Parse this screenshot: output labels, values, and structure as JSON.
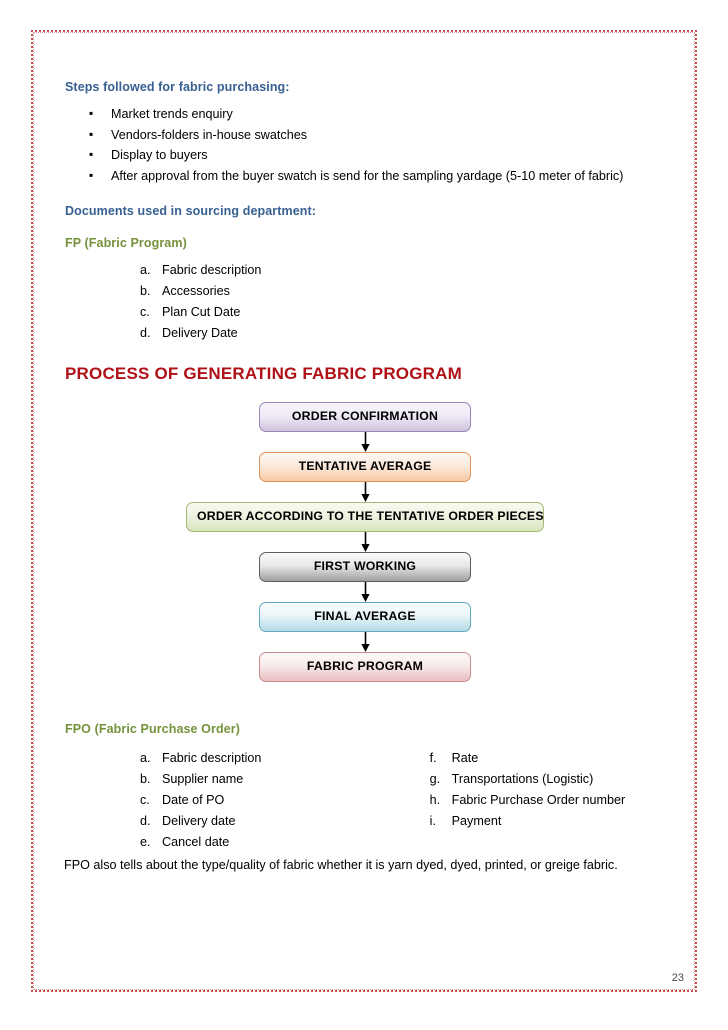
{
  "document": {
    "page_number": "23",
    "border_color": "#c0504d"
  },
  "section_steps": {
    "heading": "Steps followed for fabric purchasing:",
    "heading_color": "#376092",
    "bullets": [
      "Market trends enquiry",
      "Vendors-folders in-house swatches",
      "Display to buyers",
      "After approval from the buyer swatch is send for the sampling yardage (5-10 meter of fabric)"
    ]
  },
  "section_documents": {
    "heading": "Documents used in sourcing department:",
    "heading_color": "#376092"
  },
  "section_fp": {
    "heading": "FP (Fabric Program)",
    "heading_color": "#76923c",
    "items": [
      {
        "marker": "a.",
        "label": "Fabric description"
      },
      {
        "marker": "b.",
        "label": "Accessories"
      },
      {
        "marker": "c.",
        "label": "Plan Cut Date"
      },
      {
        "marker": "d.",
        "label": "Delivery Date"
      }
    ]
  },
  "section_process": {
    "heading": "PROCESS OF GENERATING FABRIC PROGRAM",
    "heading_color": "#b01116",
    "flowchart": {
      "steps": [
        {
          "label": "ORDER CONFIRMATION",
          "color": "#cfc3df"
        },
        {
          "label": "TENTATIVE AVERAGE",
          "color": "#f7c9a4"
        },
        {
          "label": "ORDER ACCORDING TO THE TENTATIVE ORDER PIECES",
          "color": "#d9e5be"
        },
        {
          "label": "FIRST WORKING",
          "color": "#9f9f9f"
        },
        {
          "label": "FINAL AVERAGE",
          "color": "#b3dbe6"
        },
        {
          "label": "FABRIC PROGRAM",
          "color": "#e9bfc0"
        }
      ]
    }
  },
  "section_fpo": {
    "heading": "FPO (Fabric Purchase Order)",
    "heading_color": "#76923c",
    "items_left": [
      {
        "marker": "a.",
        "label": "Fabric description"
      },
      {
        "marker": "b.",
        "label": "Supplier name"
      },
      {
        "marker": "c.",
        "label": "Date of PO"
      },
      {
        "marker": "d.",
        "label": "Delivery date"
      },
      {
        "marker": "e.",
        "label": "Cancel date"
      }
    ],
    "items_right": [
      {
        "marker": "f.",
        "label": "Rate"
      },
      {
        "marker": "g.",
        "label": "Transportations (Logistic)"
      },
      {
        "marker": "h.",
        "label": "Fabric Purchase Order number"
      },
      {
        "marker": "i.",
        "label": "Payment"
      }
    ],
    "trailing_paragraph": "FPO also tells about the type/quality of fabric whether it is yarn dyed, dyed, printed, or greige fabric."
  }
}
